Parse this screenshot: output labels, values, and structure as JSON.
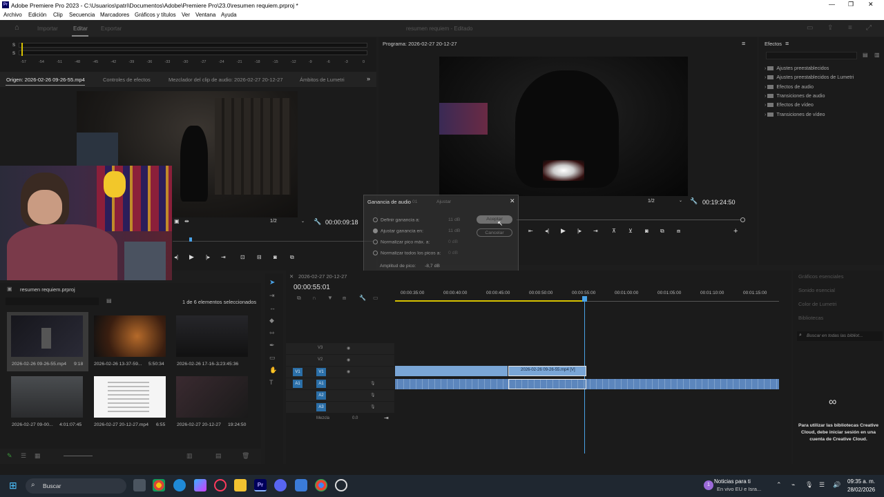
{
  "window": {
    "title": "Adobe Premiere Pro 2023 - C:\\Usuarios\\patri\\Documentos\\Adobe\\Premiere Pro\\23.0\\resumen requiem.prproj *"
  },
  "menu": [
    "Archivo",
    "Edición",
    "Clip",
    "Secuencia",
    "Marcadores",
    "Gráficos y títulos",
    "Ver",
    "Ventana",
    "Ayuda"
  ],
  "workspace": {
    "tabs": [
      "Importar",
      "Editar",
      "Exportar"
    ],
    "project_title": "resumen requiem - Editado"
  },
  "audio_meter": {
    "labels": [
      "S",
      "S"
    ],
    "scale": [
      "-57",
      "-54",
      "-51",
      "-48",
      "-45",
      "-42",
      "-39",
      "-36",
      "-33",
      "-30",
      "-27",
      "-24",
      "-21",
      "-18",
      "-15",
      "-12",
      "-9",
      "-6",
      "-3",
      "0"
    ]
  },
  "source_panel": {
    "tabs": [
      "Origen: 2026-02-26 09-26-55.mp4",
      "Controles de efectos",
      "Mezclador del clip de audio: 2026-02-27 20-12-27",
      "Ámbitos de Lumetri"
    ],
    "resolution": "1/2",
    "timecode": "00:00:09:18"
  },
  "program_panel": {
    "title": "Programa: 2026-02-27 20-12-27",
    "resolution": "1/2",
    "timecode": "00:19:24:50"
  },
  "effects_panel": {
    "title": "Efectos",
    "items": [
      "Ajustes preestablecidos",
      "Ajustes preestablecidos de Lumetri",
      "Efectos de audio",
      "Transiciones de audio",
      "Efectos de vídeo",
      "Transiciones de vídeo"
    ]
  },
  "audio_gain_dialog": {
    "title": "Ganancia de audio",
    "ghost_tab": "Ajustar",
    "options": [
      {
        "label": "Definir ganancia a:",
        "value": "11 dB"
      },
      {
        "label": "Ajustar ganancia en:",
        "value": "11 dB"
      },
      {
        "label": "Normalizar pico máx. a:",
        "value": "0 dB"
      },
      {
        "label": "Normalizar todos los picos a:",
        "value": "0 dB"
      }
    ],
    "peak_label": "Amplitud de pico:",
    "peak_value": "-8,7 dB",
    "ok": "Aceptar",
    "cancel": "Cancelar",
    "ghost_timecode": "01"
  },
  "project_panel": {
    "title": "resumen requiem.prproj",
    "selection": "1 de 6 elementos seleccionados",
    "items": [
      {
        "name": "2026-02-26 09-26-55.mp4",
        "duration": "9:18"
      },
      {
        "name": "2026-02-26 13-37-59...",
        "duration": "5:50:34"
      },
      {
        "name": "2026-02-26 17-16-...",
        "duration": "3:23:45:36"
      },
      {
        "name": "2026-02-27 09-00...",
        "duration": "4:01:07:45"
      },
      {
        "name": "2026-02-27 20-12-27.mp4",
        "duration": "6:55"
      },
      {
        "name": "2026-02-27 20-12-27",
        "duration": "19:24:50"
      }
    ]
  },
  "timeline": {
    "sequence_tab": "2026-02-27 20-12-27",
    "timecode": "00:00:55:01",
    "ruler": [
      "00:00:35:00",
      "00:00:40:00",
      "00:00:45:00",
      "00:00:50:00",
      "00:00:55:00",
      "00:01:00:00",
      "00:01:05:00",
      "00:01:10:00",
      "00:01:15:00"
    ],
    "video_tracks": [
      "V3",
      "V2",
      "V1"
    ],
    "audio_tracks": [
      "A1",
      "A2",
      "A3"
    ],
    "master": "Mezcla",
    "master_value": "0.0",
    "clip_label": "2026-02-26 09-26-55.mp4 [V]"
  },
  "libraries_panel": {
    "tabs": [
      "Gráficos esenciales",
      "Sonido esencial",
      "Color de Lumetri",
      "Bibliotecas"
    ],
    "search_placeholder": "Buscar en todas las bibliot...",
    "message": "Para utilizar las bibliotecas Creative Cloud, debe iniciar sesión en una cuenta de Creative Cloud."
  },
  "taskbar": {
    "search": "Buscar",
    "news_title": "Noticias para ti",
    "news_sub": "En vivo EU e Isra...",
    "news_badge": "1",
    "time": "09:35 a. m.",
    "date": "28/02/2026"
  },
  "colors": {
    "accent": "#2b6fa8",
    "clip_video": "#7aa6d6",
    "clip_audio": "#5c86bd",
    "playhead": "#4aa3e8"
  }
}
